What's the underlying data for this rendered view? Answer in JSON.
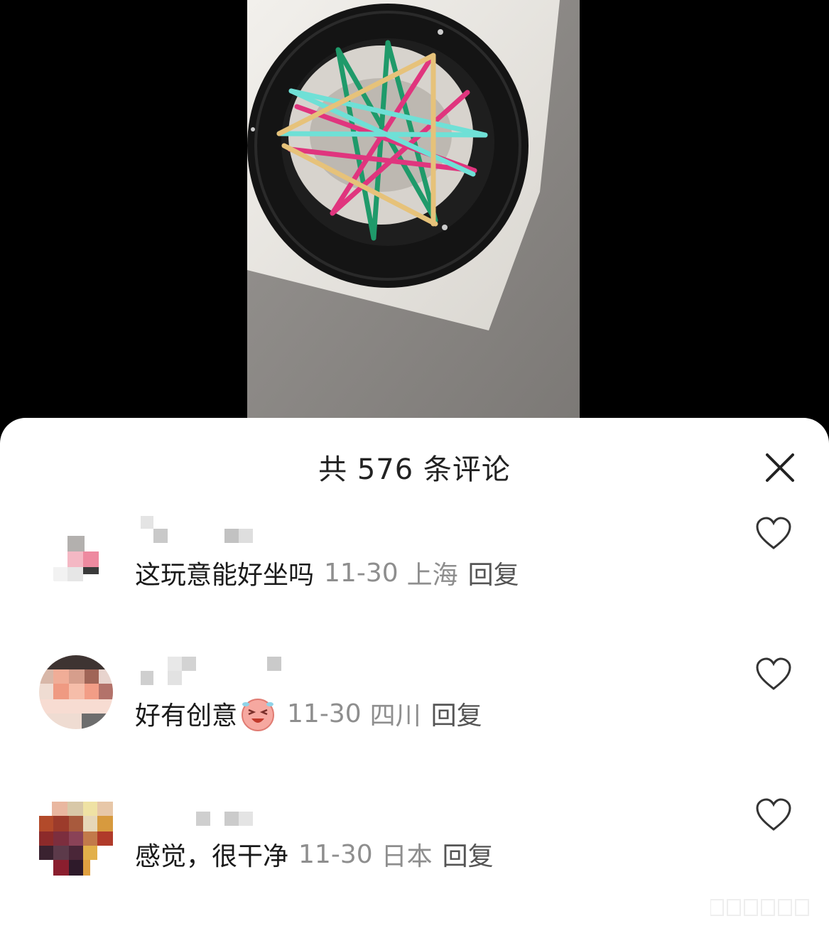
{
  "video": {
    "content": "tire-seat-with-elastic-straps"
  },
  "sheet": {
    "title": "共 576 条评论",
    "close_icon": "close-icon"
  },
  "comments": [
    {
      "text": "这玩意能好坐吗",
      "date": "11-30",
      "location": "上海",
      "reply_label": "回复",
      "has_emoji": false
    },
    {
      "text": "好有创意",
      "date": "11-30",
      "location": "四川",
      "reply_label": "回复",
      "has_emoji": true,
      "emoji": "laughing-tears-emoji"
    },
    {
      "text": "感觉，很干净",
      "date": "11-30",
      "location": "日本",
      "reply_label": "回复",
      "has_emoji": false
    }
  ],
  "colors": {
    "title": "#222222",
    "meta": "#8e8e8e",
    "strap_green": "#1f9a6a",
    "strap_pink": "#e0357e",
    "strap_cyan": "#6fe0d6",
    "strap_yellow": "#e6c27a"
  }
}
